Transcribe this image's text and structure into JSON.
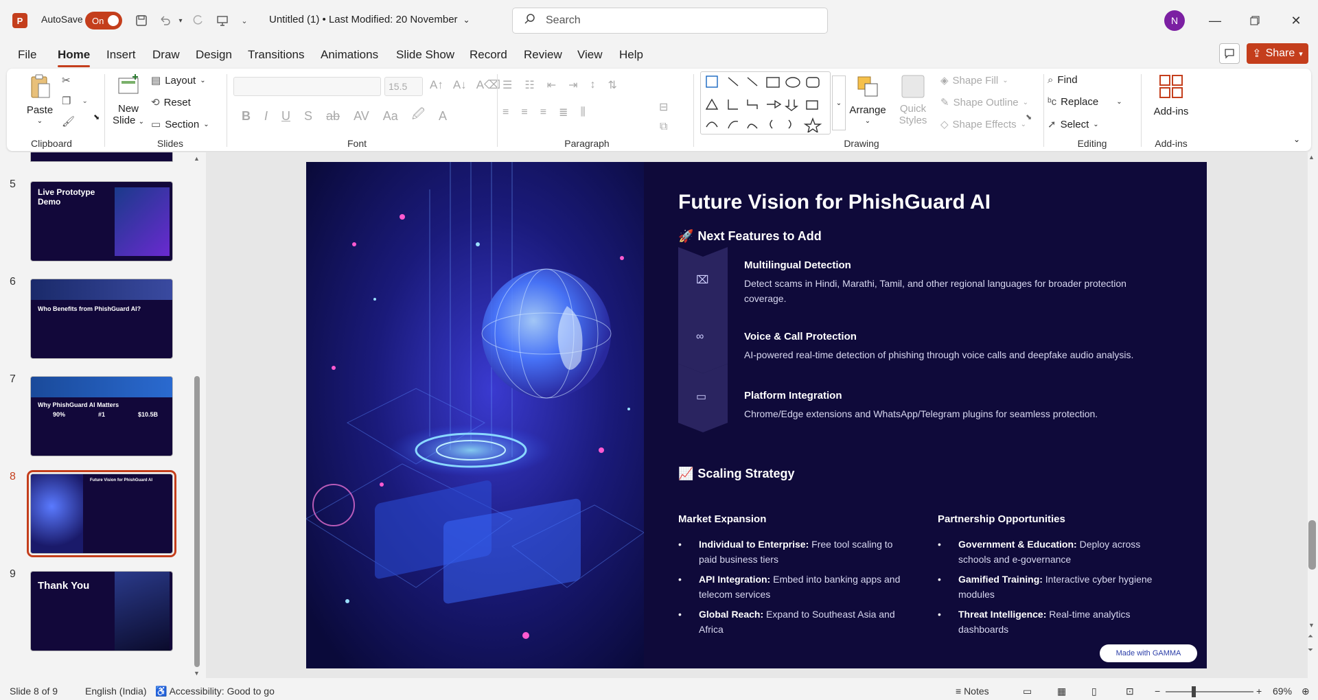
{
  "title_bar": {
    "autosave_label": "AutoSave",
    "autosave_state": "On",
    "doc_title": "Untitled (1)  •  Last Modified: 20 November",
    "search_placeholder": "Search",
    "user_initial": "N"
  },
  "tabs": [
    "File",
    "Home",
    "Insert",
    "Draw",
    "Design",
    "Transitions",
    "Animations",
    "Slide Show",
    "Record",
    "Review",
    "View",
    "Help"
  ],
  "share_label": "Share",
  "ribbon": {
    "paste": "Paste",
    "new_slide_1": "New",
    "new_slide_2": "Slide",
    "layout": "Layout",
    "reset": "Reset",
    "section": "Section",
    "font_size": "15.5",
    "arrange": "Arrange",
    "quick_styles_1": "Quick",
    "quick_styles_2": "Styles",
    "shape_fill": "Shape Fill",
    "shape_outline": "Shape Outline",
    "shape_effects": "Shape Effects",
    "find": "Find",
    "replace": "Replace",
    "select": "Select",
    "addins": "Add-ins",
    "groups": {
      "clipboard": "Clipboard",
      "slides": "Slides",
      "font": "Font",
      "paragraph": "Paragraph",
      "drawing": "Drawing",
      "editing": "Editing",
      "addins": "Add-ins"
    }
  },
  "thumbnails": [
    {
      "num": "5",
      "title": "Live Prototype Demo"
    },
    {
      "num": "6",
      "title": "Who Benefits from PhishGuard AI?"
    },
    {
      "num": "7",
      "title": "Why PhishGuard AI Matters",
      "stats": [
        "90%",
        "#1",
        "$10.5B"
      ]
    },
    {
      "num": "8",
      "title": "Future Vision for PhishGuard AI"
    },
    {
      "num": "9",
      "title": "Thank You"
    }
  ],
  "slide": {
    "title": "Future Vision for PhishGuard AI",
    "features_heading": "Next Features to Add",
    "features": [
      {
        "title": "Multilingual Detection",
        "desc": "Detect scams in Hindi, Marathi, Tamil, and other regional languages for broader protection coverage.",
        "icon": "language-icon"
      },
      {
        "title": "Voice & Call Protection",
        "desc": "AI-powered real-time detection of phishing through voice calls and deepfake audio analysis.",
        "icon": "voicemail-icon"
      },
      {
        "title": "Platform Integration",
        "desc": "Chrome/Edge extensions and WhatsApp/Telegram plugins for seamless protection.",
        "icon": "browser-window-icon"
      }
    ],
    "scaling_heading": "Scaling Strategy",
    "market": {
      "heading": "Market Expansion",
      "items": [
        {
          "bold": "Individual to Enterprise:",
          "text": " Free tool scaling to paid business tiers"
        },
        {
          "bold": "API Integration:",
          "text": " Embed into banking apps and telecom services"
        },
        {
          "bold": "Global Reach:",
          "text": " Expand to Southeast Asia and Africa"
        }
      ]
    },
    "partner": {
      "heading": "Partnership Opportunities",
      "items": [
        {
          "bold": "Government & Education:",
          "text": " Deploy across schools and e-governance"
        },
        {
          "bold": "Gamified Training:",
          "text": " Interactive cyber hygiene modules"
        },
        {
          "bold": "Threat Intelligence:",
          "text": " Real-time analytics dashboards"
        }
      ]
    },
    "made_with": "Made with GAMMA"
  },
  "status": {
    "slide_count": "Slide 8 of 9",
    "language": "English (India)",
    "accessibility": "Accessibility: Good to go",
    "notes": "Notes",
    "zoom": "69%"
  },
  "colors": {
    "accent": "#c43e1c",
    "slide_bg": "#0f0a3a"
  }
}
